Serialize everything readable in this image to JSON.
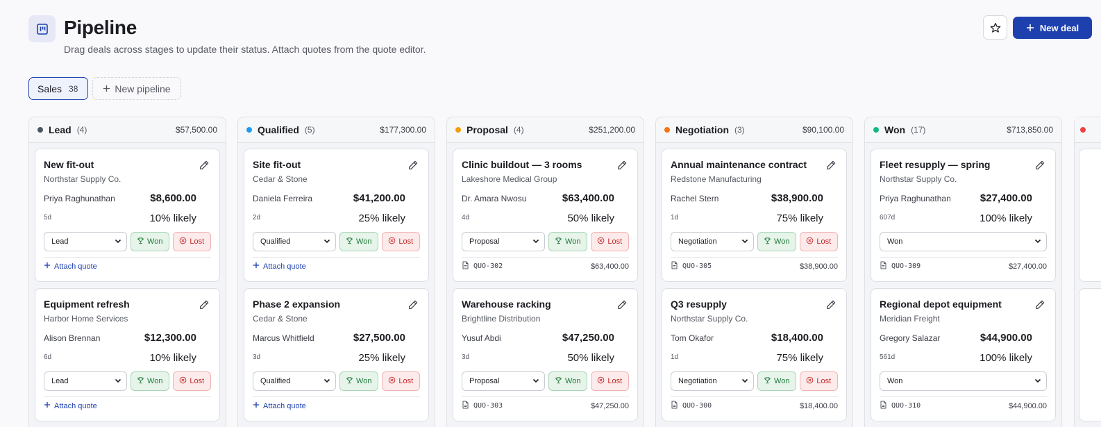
{
  "header": {
    "title": "Pipeline",
    "subtitle": "Drag deals across stages to update their status. Attach quotes from the quote editor.",
    "new_deal_label": "New deal"
  },
  "pipeline_tabs": {
    "active": {
      "label": "Sales",
      "count": "38"
    },
    "new_label": "New pipeline"
  },
  "labels": {
    "won": "Won",
    "lost": "Lost",
    "attach_quote": "Attach quote"
  },
  "colors": {
    "accent": "#1e40af",
    "lead": "#4b5563",
    "qualified": "#1d9bf0",
    "proposal": "#f59e0b",
    "negotiation": "#f97316",
    "won": "#10b981",
    "next": "#ef4444"
  },
  "columns": [
    {
      "name": "Lead",
      "count": "(4)",
      "total": "$57,500.00",
      "color": "#4b5563",
      "cards": [
        {
          "title": "New fit-out",
          "company": "Northstar Supply Co.",
          "owner": "Priya Raghunathan",
          "amount": "$8,600.00",
          "age": "5d",
          "likely": "10% likely",
          "stage": "Lead"
        },
        {
          "title": "Equipment refresh",
          "company": "Harbor Home Services",
          "owner": "Alison Brennan",
          "amount": "$12,300.00",
          "age": "6d",
          "likely": "10% likely",
          "stage": "Lead"
        }
      ]
    },
    {
      "name": "Qualified",
      "count": "(5)",
      "total": "$177,300.00",
      "color": "#1d9bf0",
      "cards": [
        {
          "title": "Site fit-out",
          "company": "Cedar & Stone",
          "owner": "Daniela Ferreira",
          "amount": "$41,200.00",
          "age": "2d",
          "likely": "25% likely",
          "stage": "Qualified"
        },
        {
          "title": "Phase 2 expansion",
          "company": "Cedar & Stone",
          "owner": "Marcus Whitfield",
          "amount": "$27,500.00",
          "age": "3d",
          "likely": "25% likely",
          "stage": "Qualified"
        }
      ]
    },
    {
      "name": "Proposal",
      "count": "(4)",
      "total": "$251,200.00",
      "color": "#f59e0b",
      "cards": [
        {
          "title": "Clinic buildout — 3 rooms",
          "company": "Lakeshore Medical Group",
          "owner": "Dr. Amara Nwosu",
          "amount": "$63,400.00",
          "age": "4d",
          "likely": "50% likely",
          "stage": "Proposal",
          "quote": "QUO-302",
          "quote_amount": "$63,400.00"
        },
        {
          "title": "Warehouse racking",
          "company": "Brightline Distribution",
          "owner": "Yusuf Abdi",
          "amount": "$47,250.00",
          "age": "3d",
          "likely": "50% likely",
          "stage": "Proposal",
          "quote": "QUO-303",
          "quote_amount": "$47,250.00"
        }
      ]
    },
    {
      "name": "Negotiation",
      "count": "(3)",
      "total": "$90,100.00",
      "color": "#f97316",
      "cards": [
        {
          "title": "Annual maintenance contract",
          "company": "Redstone Manufacturing",
          "owner": "Rachel Stern",
          "amount": "$38,900.00",
          "age": "1d",
          "likely": "75% likely",
          "stage": "Negotiation",
          "quote": "QUO-305",
          "quote_amount": "$38,900.00"
        },
        {
          "title": "Q3 resupply",
          "company": "Northstar Supply Co.",
          "owner": "Tom Okafor",
          "amount": "$18,400.00",
          "age": "1d",
          "likely": "75% likely",
          "stage": "Negotiation",
          "quote": "QUO-300",
          "quote_amount": "$18,400.00"
        }
      ]
    },
    {
      "name": "Won",
      "count": "(17)",
      "total": "$713,850.00",
      "color": "#10b981",
      "cards": [
        {
          "title": "Fleet resupply — spring",
          "company": "Northstar Supply Co.",
          "owner": "Priya Raghunathan",
          "amount": "$27,400.00",
          "age": "607d",
          "likely": "100% likely",
          "stage": "Won",
          "closed": true,
          "quote": "QUO-309",
          "quote_amount": "$27,400.00"
        },
        {
          "title": "Regional depot equipment",
          "company": "Meridian Freight",
          "owner": "Gregory Salazar",
          "amount": "$44,900.00",
          "age": "561d",
          "likely": "100% likely",
          "stage": "Won",
          "closed": true,
          "quote": "QUO-310",
          "quote_amount": "$44,900.00"
        }
      ]
    }
  ]
}
